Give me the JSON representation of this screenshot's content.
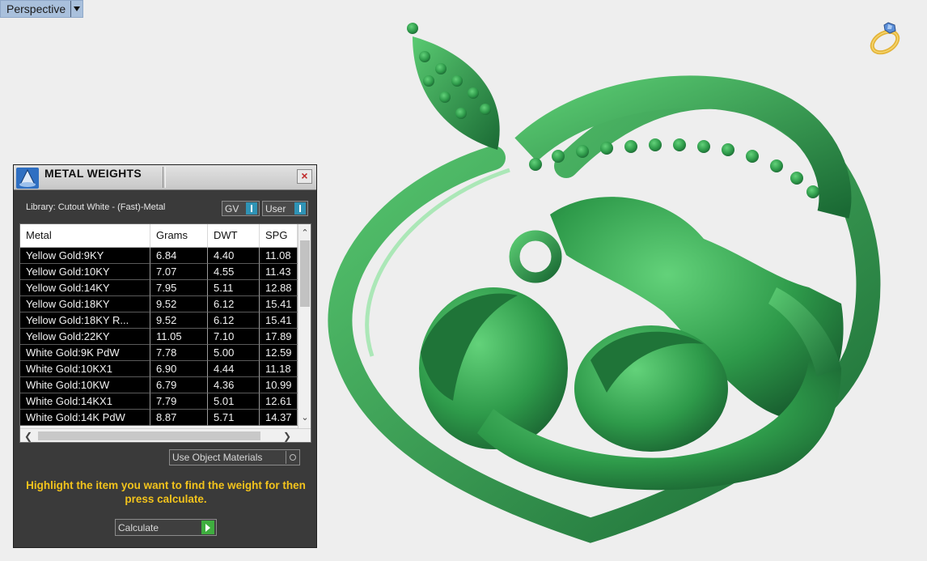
{
  "viewport": {
    "label": "Perspective"
  },
  "panel": {
    "title": "METAL WEIGHTS",
    "close_glyph": "×",
    "library": "Library: Cutout White - (Fast)-Metal",
    "toggles": {
      "gv": "GV",
      "user": "User"
    },
    "columns": [
      "Metal",
      "Grams",
      "DWT",
      "SPG"
    ],
    "rows": [
      [
        "Yellow Gold:9KY",
        "6.84",
        "4.40",
        "11.08"
      ],
      [
        "Yellow Gold:10KY",
        "7.07",
        "4.55",
        "11.43"
      ],
      [
        "Yellow Gold:14KY",
        "7.95",
        "5.11",
        "12.88"
      ],
      [
        "Yellow Gold:18KY",
        "9.52",
        "6.12",
        "15.41"
      ],
      [
        "Yellow Gold:18KY R...",
        "9.52",
        "6.12",
        "15.41"
      ],
      [
        "Yellow Gold:22KY",
        "11.05",
        "7.10",
        "17.89"
      ],
      [
        "White Gold:9K PdW",
        "7.78",
        "5.00",
        "12.59"
      ],
      [
        "White Gold:10KX1",
        "6.90",
        "4.44",
        "11.18"
      ],
      [
        "White Gold:10KW",
        "6.79",
        "4.36",
        "10.99"
      ],
      [
        "White Gold:14KX1",
        "7.79",
        "5.01",
        "12.61"
      ],
      [
        "White Gold:14K PdW",
        "8.87",
        "5.71",
        "14.37"
      ]
    ],
    "use_object_materials": "Use Object Materials",
    "hint": "Highlight the item you want to find the weight for then press calculate.",
    "calculate_label": "Calculate"
  },
  "colors": {
    "model": "#2e9a4a",
    "hint": "#f2c31c",
    "panel_bg": "#3a3a3a"
  },
  "icons": {
    "ring": "ring-icon",
    "title": "metal-weights-app-icon"
  }
}
